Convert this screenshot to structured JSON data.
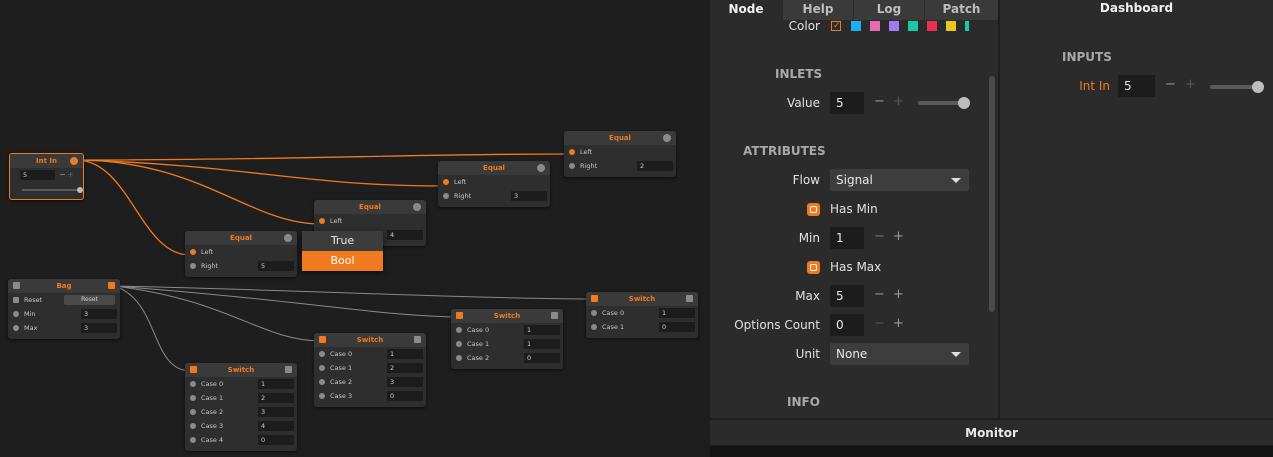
{
  "graph": {
    "int_in": {
      "title": "Int In",
      "value": "5"
    },
    "equal_a": {
      "title": "Equal",
      "left": "Left",
      "right": "Right",
      "right_value": "2"
    },
    "equal_b": {
      "title": "Equal",
      "left": "Left",
      "right": "Right",
      "right_value": "3"
    },
    "equal_c": {
      "title": "Equal",
      "left": "Left",
      "right_value": "4"
    },
    "equal_d": {
      "title": "Equal",
      "left": "Left",
      "right": "Right",
      "right_value": "5"
    },
    "bag": {
      "title": "Bag",
      "reset": "Reset",
      "reset_button": "Reset",
      "min": "Min",
      "min_value": "3",
      "max": "Max",
      "max_value": "3"
    },
    "switch_a": {
      "title": "Switch",
      "rows": [
        {
          "label": "Case 0",
          "value": "1"
        },
        {
          "label": "Case 1",
          "value": "0"
        }
      ]
    },
    "switch_b": {
      "title": "Switch",
      "rows": [
        {
          "label": "Case 0",
          "value": "1"
        },
        {
          "label": "Case 1",
          "value": "1"
        },
        {
          "label": "Case 2",
          "value": "0"
        }
      ]
    },
    "switch_c": {
      "title": "Switch",
      "rows": [
        {
          "label": "Case 0",
          "value": "1"
        },
        {
          "label": "Case 1",
          "value": "2"
        },
        {
          "label": "Case 2",
          "value": "3"
        },
        {
          "label": "Case 3",
          "value": "0"
        }
      ]
    },
    "switch_d": {
      "title": "Switch",
      "rows": [
        {
          "label": "Case 0",
          "value": "1"
        },
        {
          "label": "Case 1",
          "value": "2"
        },
        {
          "label": "Case 2",
          "value": "3"
        },
        {
          "label": "Case 3",
          "value": "4"
        },
        {
          "label": "Case 4",
          "value": "0"
        }
      ]
    },
    "popup": {
      "items": [
        "True",
        "Bool"
      ],
      "selected": "Bool"
    }
  },
  "panel": {
    "tabs": [
      "Node",
      "Help",
      "Log",
      "Patch"
    ],
    "active_tab": "Node",
    "color_label": "Color",
    "swatches": [
      "#f07a20",
      "#1ab0f0",
      "#e86bb0",
      "#a07af0",
      "#1ac8a8",
      "#e83050",
      "#e8c820",
      "#20c8a0"
    ],
    "inlets_title": "INLETS",
    "value_label": "Value",
    "value": "5",
    "attributes_title": "ATTRIBUTES",
    "flow_label": "Flow",
    "flow_value": "Signal",
    "has_min_label": "Has Min",
    "min_label": "Min",
    "min_value": "1",
    "has_max_label": "Has Max",
    "max_label": "Max",
    "max_value": "5",
    "options_count_label": "Options Count",
    "options_count_value": "0",
    "unit_label": "Unit",
    "unit_value": "None",
    "info_title": "INFO",
    "minus": "−",
    "plus": "+"
  },
  "dashboard": {
    "title": "Dashboard",
    "inputs_title": "INPUTS",
    "int_in_label": "Int In",
    "int_in_value": "5",
    "minus": "−",
    "plus": "+"
  },
  "monitor": {
    "title": "Monitor"
  },
  "colors": {
    "accent": "#f07a20",
    "wire_active": "#f07a20",
    "wire_idle": "#8a8a8a"
  }
}
